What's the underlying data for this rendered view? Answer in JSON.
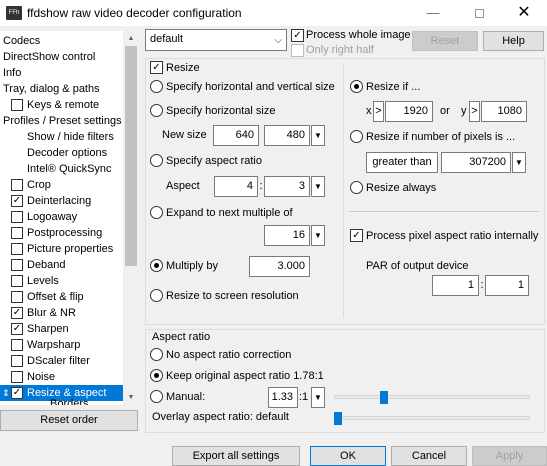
{
  "window": {
    "title": "ffdshow raw video decoder configuration",
    "icon_text": "FFh",
    "minimize": "—",
    "close": "✕"
  },
  "tree": {
    "items": [
      {
        "label": "Codecs",
        "checkbox": null
      },
      {
        "label": "DirectShow control",
        "checkbox": null
      },
      {
        "label": "Info",
        "checkbox": null
      },
      {
        "label": "Tray, dialog & paths",
        "checkbox": null
      },
      {
        "label": "Keys & remote",
        "checkbox": false
      },
      {
        "label": "Profiles / Preset settings",
        "checkbox": null
      },
      {
        "label": "Show / hide filters",
        "checkbox": null
      },
      {
        "label": "Decoder options",
        "checkbox": null
      },
      {
        "label": "Intel® QuickSync",
        "checkbox": null
      },
      {
        "label": "Crop",
        "checkbox": false
      },
      {
        "label": "Deinterlacing",
        "checkbox": true
      },
      {
        "label": "Logoaway",
        "checkbox": false
      },
      {
        "label": "Postprocessing",
        "checkbox": false
      },
      {
        "label": "Picture properties",
        "checkbox": false
      },
      {
        "label": "Deband",
        "checkbox": false
      },
      {
        "label": "Levels",
        "checkbox": false
      },
      {
        "label": "Offset & flip",
        "checkbox": false
      },
      {
        "label": "Blur & NR",
        "checkbox": true
      },
      {
        "label": "Sharpen",
        "checkbox": true
      },
      {
        "label": "Warpsharp",
        "checkbox": false
      },
      {
        "label": "DScaler filter",
        "checkbox": false
      },
      {
        "label": "Noise",
        "checkbox": false
      },
      {
        "label": "Resize & aspect",
        "checkbox": true
      },
      {
        "label": "Borders",
        "checkbox": null
      }
    ],
    "reset_order": "Reset order"
  },
  "preset": {
    "value": "default",
    "process_whole_image": "Process whole image",
    "only_right_half": "Only right half",
    "reset": "Reset",
    "help": "Help"
  },
  "resize": {
    "title": "Resize",
    "specify_hv": "Specify horizontal and vertical size",
    "specify_h": "Specify horizontal size",
    "new_size_label": "New size",
    "new_size_w": "640",
    "new_size_h": "480",
    "specify_aspect": "Specify aspect ratio",
    "aspect_label": "Aspect",
    "aspect_w": "4",
    "aspect_h": "3",
    "aspect_sep": ":",
    "expand_multiple": "Expand to next multiple of",
    "multiple_value": "16",
    "multiply_by": "Multiply by",
    "multiply_value": "3.000",
    "resize_screen": "Resize to screen resolution",
    "resize_if": "Resize if ...",
    "x_label": "x",
    "gt1": ">",
    "width_value": "1920",
    "or_label": "or",
    "y_label": "y",
    "gt2": ">",
    "height_value": "1080",
    "resize_if_pixels": "Resize if number of pixels is ...",
    "greater_than": "greater than",
    "pixels_value": "307200",
    "resize_always": "Resize always",
    "process_par": "Process pixel aspect ratio internally",
    "par_output_label": "PAR of output device",
    "par_w": "1",
    "par_h": "1",
    "par_sep": ":"
  },
  "aspect": {
    "title": "Aspect ratio",
    "no_correction": "No aspect ratio correction",
    "keep_original": "Keep original aspect ratio 1.78:1",
    "manual": "Manual:",
    "manual_value": "1.33",
    "manual_suffix": ":1",
    "overlay": "Overlay aspect ratio: default"
  },
  "buttons": {
    "export": "Export all settings",
    "ok": "OK",
    "cancel": "Cancel",
    "apply": "Apply"
  },
  "colors": {
    "selection": "#0078d7",
    "background": "#f0f0f0"
  }
}
